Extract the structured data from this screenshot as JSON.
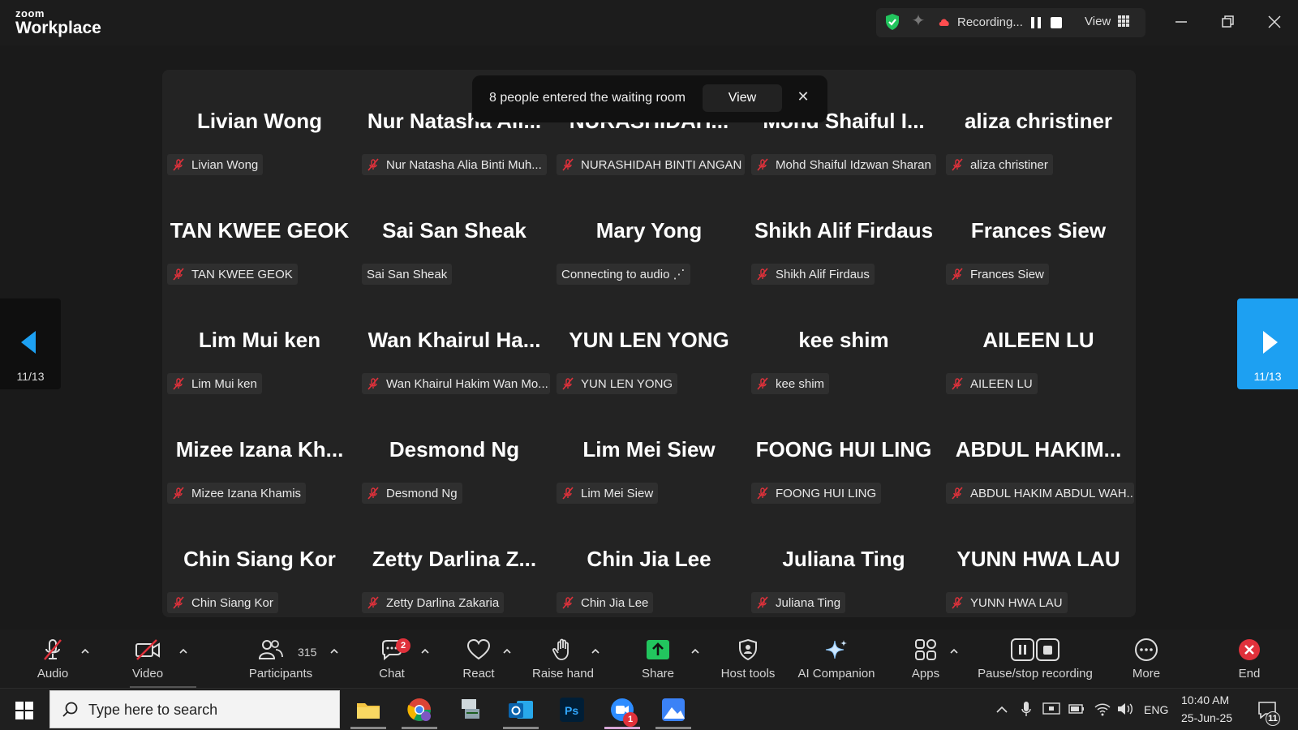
{
  "app": {
    "logo_small": "zoom",
    "logo_large": "Workplace"
  },
  "topbar": {
    "recording_label": "Recording...",
    "view_label": "View"
  },
  "toast": {
    "message": "8 people entered the waiting room",
    "view_label": "View",
    "close": "✕"
  },
  "pagination": {
    "left": "11/13",
    "right": "11/13"
  },
  "participants": [
    {
      "display": "Livian Wong",
      "label": "Livian Wong",
      "muted": true
    },
    {
      "display": "Nur Natasha Ali...",
      "label": "Nur Natasha Alia Binti Muh...",
      "muted": true
    },
    {
      "display": "NURASHIDAH...",
      "label": "NURASHIDAH BINTI ANGAN",
      "muted": true
    },
    {
      "display": "Mohd Shaiful I...",
      "label": "Mohd Shaiful Idzwan Sharan",
      "muted": true
    },
    {
      "display": "aliza christiner",
      "label": "aliza christiner",
      "muted": true
    },
    {
      "display": "TAN KWEE GEOK",
      "label": "TAN KWEE GEOK",
      "muted": true
    },
    {
      "display": "Sai San Sheak",
      "label": "Sai San Sheak",
      "muted": false
    },
    {
      "display": "Mary Yong",
      "label": "Connecting to audio ⋰",
      "muted": false
    },
    {
      "display": "Shikh Alif Firdaus",
      "label": "Shikh Alif Firdaus",
      "muted": true
    },
    {
      "display": "Frances Siew",
      "label": "Frances Siew",
      "muted": true
    },
    {
      "display": "Lim Mui ken",
      "label": "Lim Mui ken",
      "muted": true
    },
    {
      "display": "Wan Khairul Ha...",
      "label": "Wan Khairul Hakim Wan Mo...",
      "muted": true
    },
    {
      "display": "YUN LEN YONG",
      "label": "YUN LEN YONG",
      "muted": true
    },
    {
      "display": "kee shim",
      "label": "kee shim",
      "muted": true
    },
    {
      "display": "AILEEN LU",
      "label": "AILEEN LU",
      "muted": true
    },
    {
      "display": "Mizee Izana Kh...",
      "label": "Mizee Izana Khamis",
      "muted": true
    },
    {
      "display": "Desmond Ng",
      "label": "Desmond Ng",
      "muted": true
    },
    {
      "display": "Lim Mei Siew",
      "label": "Lim Mei Siew",
      "muted": true
    },
    {
      "display": "FOONG HUI LING",
      "label": "FOONG HUI LING",
      "muted": true
    },
    {
      "display": "ABDUL HAKIM...",
      "label": "ABDUL HAKIM ABDUL WAH...",
      "muted": true
    },
    {
      "display": "Chin Siang Kor",
      "label": "Chin Siang Kor",
      "muted": true
    },
    {
      "display": "Zetty Darlina Z...",
      "label": "Zetty Darlina Zakaria",
      "muted": true
    },
    {
      "display": "Chin Jia Lee",
      "label": "Chin Jia Lee",
      "muted": true
    },
    {
      "display": "Juliana Ting",
      "label": "Juliana Ting",
      "muted": true
    },
    {
      "display": "YUNN HWA LAU",
      "label": "YUNN HWA LAU",
      "muted": true
    }
  ],
  "toolbar": {
    "audio": "Audio",
    "video": "Video",
    "participants": "Participants",
    "participants_count": "315",
    "chat": "Chat",
    "chat_badge": "2",
    "react": "React",
    "raise_hand": "Raise hand",
    "share": "Share",
    "host_tools": "Host tools",
    "ai_companion": "AI Companion",
    "apps": "Apps",
    "pause_stop": "Pause/stop recording",
    "more": "More",
    "end": "End"
  },
  "taskbar": {
    "search_placeholder": "Type here to search",
    "lang": "ENG",
    "time": "10:40 AM",
    "date": "25-Jun-25",
    "notification_count": "11",
    "zoom_badge": "1"
  },
  "colors": {
    "accent_blue": "#1da0f2",
    "muted_red": "#e0313b",
    "share_green": "#22c55e"
  }
}
